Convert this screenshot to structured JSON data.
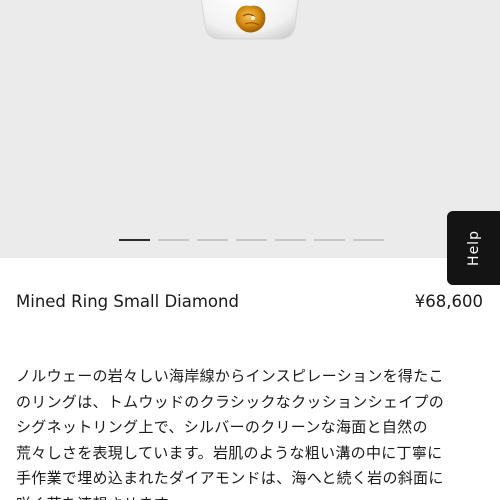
{
  "product": {
    "name": "Mined Ring Small Diamond",
    "price": "¥68,600",
    "description_lines": [
      "ノルウェーの岩々しい海岸線からインスピレーションを得たこ",
      "のリングは、トムウッドのクラシックなクッションシェイプの",
      "シグネットリング上で、シルバーのクリーンな海面と自然の",
      "荒々しさを表現しています。岩肌のような粗い溝の中に丁寧に",
      "手作業で埋め込まれたダイアモンドは、海へと続く岩の斜面に",
      "咲く花を連想させます。"
    ]
  },
  "gallery": {
    "image_count": 7,
    "active_index": 0,
    "image_subject": "ring-product-image"
  },
  "help": {
    "label": "Help"
  },
  "colors": {
    "gallery_background": "#ebebeb",
    "help_background": "#141414",
    "active_dot": "#2a2a2a",
    "inactive_dot": "#c8c8c8",
    "text": "#1a1a1a"
  }
}
